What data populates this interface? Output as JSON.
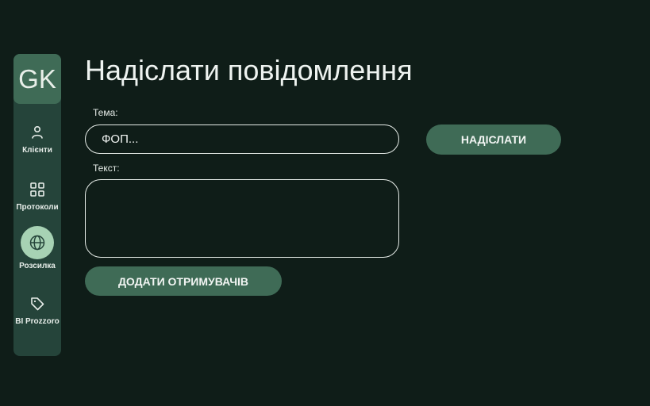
{
  "sidebar": {
    "logo": "GK",
    "items": [
      {
        "label": "Клієнти",
        "icon": "person-icon",
        "active": false
      },
      {
        "label": "Протоколи",
        "icon": "grid-icon",
        "active": false
      },
      {
        "label": "Розсилка",
        "icon": "globe-icon",
        "active": true
      },
      {
        "label": "BI Prozzoro",
        "icon": "tag-icon",
        "active": false
      }
    ]
  },
  "main": {
    "title": "Надіслати повідомлення",
    "subject": {
      "label": "Тема:",
      "value": "ФОП..."
    },
    "text": {
      "label": "Текст:",
      "value": ""
    },
    "send_label": "НАДІСЛАТИ",
    "add_recipients_label": "ДОДАТИ ОТРИМУВАЧІВ"
  },
  "colors": {
    "background": "#0f1d18",
    "sidebar": "#25443a",
    "accent": "#3f6b56",
    "active_nav": "#a7d2b4"
  }
}
